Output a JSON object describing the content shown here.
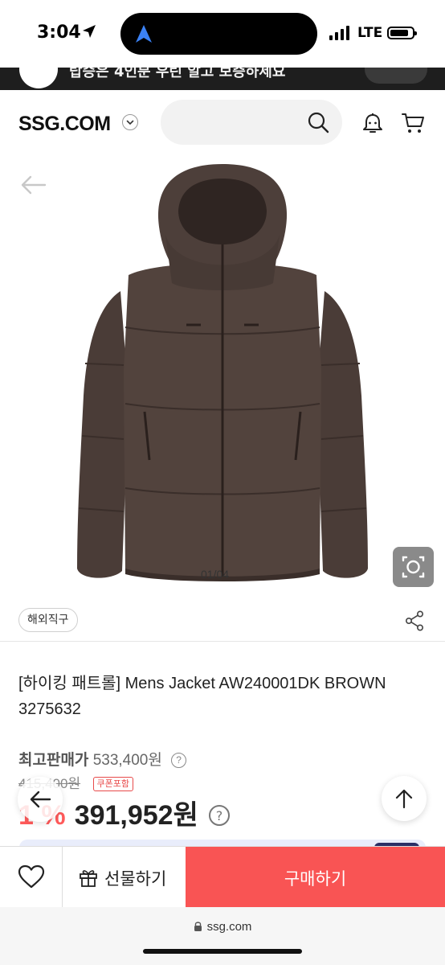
{
  "status_bar": {
    "time": "3:04",
    "network": "LTE",
    "battery_level": 0.85
  },
  "banner": {
    "text": "탑승은 4인분 우린 알고 보증하세요"
  },
  "header": {
    "logo": "SSG.COM",
    "search_placeholder": ""
  },
  "gallery": {
    "counter": "01/04"
  },
  "tags": {
    "overseas_badge": "해외직구"
  },
  "product": {
    "title": "[하이킹 패트롤] Mens Jacket AW240001DK BROWN 3275632",
    "max_price_label": "최고판매가",
    "max_price": "533,400원",
    "original_price": "415,400원",
    "coupon_label": "쿠폰포함",
    "discount": "1 %",
    "final_price": "391,952원",
    "help_glyph": "?"
  },
  "actions": {
    "gift_label": "선물하기",
    "buy_label": "구매하기"
  },
  "browser": {
    "url": "ssg.com"
  },
  "colors": {
    "buy_button": "#f95454",
    "discount": "#ff5a5a",
    "jacket": "#4a3b36"
  }
}
